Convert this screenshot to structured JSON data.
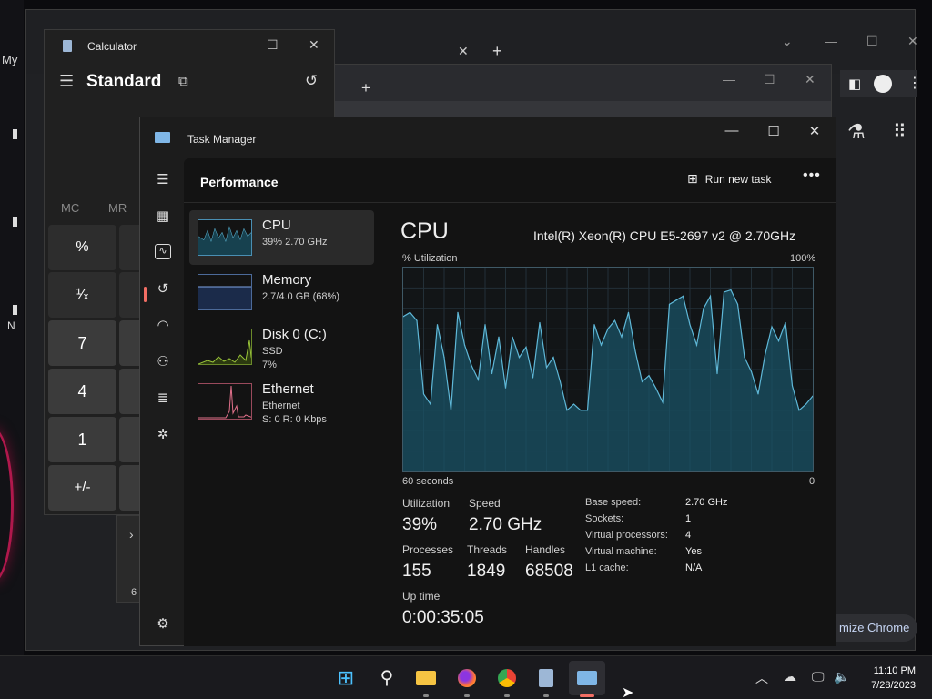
{
  "desktop": {
    "label_top": "My",
    "label_mid": "N"
  },
  "chrome_back": {
    "customize_label": "mize Chrome"
  },
  "calculator": {
    "title": "Calculator",
    "mode": "Standard",
    "memory": [
      "MC",
      "MR"
    ],
    "keys": [
      "%",
      "¹⁄ₓ",
      "7",
      "4",
      "1",
      "+/-"
    ],
    "partial_chevron": "›",
    "partial_digit": "6"
  },
  "task_manager": {
    "title": "Task Manager",
    "header": "Performance",
    "run_new_task": "Run new task",
    "items": [
      {
        "name": "CPU",
        "sub1": "39%  2.70 GHz",
        "sub2": "",
        "sub3": ""
      },
      {
        "name": "Memory",
        "sub1": "2.7/4.0 GB (68%)",
        "sub2": "",
        "sub3": ""
      },
      {
        "name": "Disk 0 (C:)",
        "sub1": "SSD",
        "sub2": "7%",
        "sub3": ""
      },
      {
        "name": "Ethernet",
        "sub1": "Ethernet",
        "sub2": "S: 0  R: 0 Kbps",
        "sub3": ""
      }
    ],
    "cpu": {
      "heading": "CPU",
      "model": "Intel(R) Xeon(R) CPU E5-2697 v2 @ 2.70GHz",
      "util_label": "% Utilization",
      "util_max": "100%",
      "time_label": "60 seconds",
      "time_min": "0",
      "stats": {
        "utilization_label": "Utilization",
        "utilization": "39%",
        "speed_label": "Speed",
        "speed": "2.70 GHz",
        "processes_label": "Processes",
        "processes": "155",
        "threads_label": "Threads",
        "threads": "1849",
        "handles_label": "Handles",
        "handles": "68508",
        "uptime_label": "Up time",
        "uptime": "0:00:35:05"
      },
      "specs": [
        {
          "k": "Base speed:",
          "v": "2.70 GHz"
        },
        {
          "k": "Sockets:",
          "v": "1"
        },
        {
          "k": "Virtual processors:",
          "v": "4"
        },
        {
          "k": "Virtual machine:",
          "v": "Yes"
        },
        {
          "k": "L1 cache:",
          "v": "N/A"
        }
      ]
    }
  },
  "chart_data": {
    "type": "area",
    "title": "",
    "xlabel": "60 seconds",
    "ylabel": "% Utilization",
    "ylim": [
      0,
      100
    ],
    "x": [
      60,
      59,
      58,
      57,
      56,
      55,
      54,
      53,
      52,
      51,
      50,
      49,
      48,
      47,
      46,
      45,
      44,
      43,
      42,
      41,
      40,
      39,
      38,
      37,
      36,
      35,
      34,
      33,
      32,
      31,
      30,
      29,
      28,
      27,
      26,
      25,
      24,
      23,
      22,
      21,
      20,
      19,
      18,
      17,
      16,
      15,
      14,
      13,
      12,
      11,
      10,
      9,
      8,
      7,
      6,
      5,
      4,
      3,
      2,
      1,
      0
    ],
    "values": [
      76,
      78,
      74,
      38,
      33,
      72,
      56,
      30,
      78,
      62,
      52,
      45,
      72,
      48,
      66,
      41,
      66,
      56,
      61,
      46,
      73,
      51,
      56,
      44,
      30,
      33,
      30,
      30,
      72,
      62,
      70,
      74,
      66,
      78,
      59,
      44,
      47,
      41,
      34,
      82,
      84,
      86,
      72,
      62,
      80,
      86,
      48,
      88,
      89,
      82,
      56,
      49,
      38,
      57,
      71,
      64,
      73,
      42,
      30,
      33,
      37
    ],
    "color": "#5fb8d8"
  },
  "taskbar": {
    "icons": [
      "start-icon",
      "search-icon",
      "file-explorer-icon",
      "firefox-icon",
      "chrome-icon",
      "calculator-icon",
      "task-manager-icon"
    ],
    "time": "11:10 PM",
    "date": "7/28/2023"
  }
}
